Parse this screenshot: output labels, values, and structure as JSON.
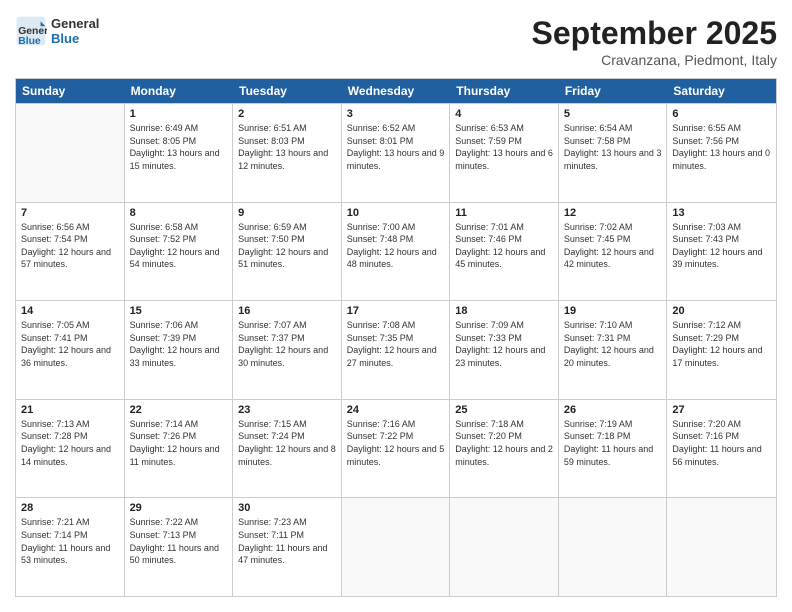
{
  "header": {
    "logo_general": "General",
    "logo_blue": "Blue",
    "month_title": "September 2025",
    "subtitle": "Cravanzana, Piedmont, Italy"
  },
  "days_of_week": [
    "Sunday",
    "Monday",
    "Tuesday",
    "Wednesday",
    "Thursday",
    "Friday",
    "Saturday"
  ],
  "weeks": [
    [
      {
        "day": "",
        "sunrise": "",
        "sunset": "",
        "daylight": ""
      },
      {
        "day": "1",
        "sunrise": "Sunrise: 6:49 AM",
        "sunset": "Sunset: 8:05 PM",
        "daylight": "Daylight: 13 hours and 15 minutes."
      },
      {
        "day": "2",
        "sunrise": "Sunrise: 6:51 AM",
        "sunset": "Sunset: 8:03 PM",
        "daylight": "Daylight: 13 hours and 12 minutes."
      },
      {
        "day": "3",
        "sunrise": "Sunrise: 6:52 AM",
        "sunset": "Sunset: 8:01 PM",
        "daylight": "Daylight: 13 hours and 9 minutes."
      },
      {
        "day": "4",
        "sunrise": "Sunrise: 6:53 AM",
        "sunset": "Sunset: 7:59 PM",
        "daylight": "Daylight: 13 hours and 6 minutes."
      },
      {
        "day": "5",
        "sunrise": "Sunrise: 6:54 AM",
        "sunset": "Sunset: 7:58 PM",
        "daylight": "Daylight: 13 hours and 3 minutes."
      },
      {
        "day": "6",
        "sunrise": "Sunrise: 6:55 AM",
        "sunset": "Sunset: 7:56 PM",
        "daylight": "Daylight: 13 hours and 0 minutes."
      }
    ],
    [
      {
        "day": "7",
        "sunrise": "Sunrise: 6:56 AM",
        "sunset": "Sunset: 7:54 PM",
        "daylight": "Daylight: 12 hours and 57 minutes."
      },
      {
        "day": "8",
        "sunrise": "Sunrise: 6:58 AM",
        "sunset": "Sunset: 7:52 PM",
        "daylight": "Daylight: 12 hours and 54 minutes."
      },
      {
        "day": "9",
        "sunrise": "Sunrise: 6:59 AM",
        "sunset": "Sunset: 7:50 PM",
        "daylight": "Daylight: 12 hours and 51 minutes."
      },
      {
        "day": "10",
        "sunrise": "Sunrise: 7:00 AM",
        "sunset": "Sunset: 7:48 PM",
        "daylight": "Daylight: 12 hours and 48 minutes."
      },
      {
        "day": "11",
        "sunrise": "Sunrise: 7:01 AM",
        "sunset": "Sunset: 7:46 PM",
        "daylight": "Daylight: 12 hours and 45 minutes."
      },
      {
        "day": "12",
        "sunrise": "Sunrise: 7:02 AM",
        "sunset": "Sunset: 7:45 PM",
        "daylight": "Daylight: 12 hours and 42 minutes."
      },
      {
        "day": "13",
        "sunrise": "Sunrise: 7:03 AM",
        "sunset": "Sunset: 7:43 PM",
        "daylight": "Daylight: 12 hours and 39 minutes."
      }
    ],
    [
      {
        "day": "14",
        "sunrise": "Sunrise: 7:05 AM",
        "sunset": "Sunset: 7:41 PM",
        "daylight": "Daylight: 12 hours and 36 minutes."
      },
      {
        "day": "15",
        "sunrise": "Sunrise: 7:06 AM",
        "sunset": "Sunset: 7:39 PM",
        "daylight": "Daylight: 12 hours and 33 minutes."
      },
      {
        "day": "16",
        "sunrise": "Sunrise: 7:07 AM",
        "sunset": "Sunset: 7:37 PM",
        "daylight": "Daylight: 12 hours and 30 minutes."
      },
      {
        "day": "17",
        "sunrise": "Sunrise: 7:08 AM",
        "sunset": "Sunset: 7:35 PM",
        "daylight": "Daylight: 12 hours and 27 minutes."
      },
      {
        "day": "18",
        "sunrise": "Sunrise: 7:09 AM",
        "sunset": "Sunset: 7:33 PM",
        "daylight": "Daylight: 12 hours and 23 minutes."
      },
      {
        "day": "19",
        "sunrise": "Sunrise: 7:10 AM",
        "sunset": "Sunset: 7:31 PM",
        "daylight": "Daylight: 12 hours and 20 minutes."
      },
      {
        "day": "20",
        "sunrise": "Sunrise: 7:12 AM",
        "sunset": "Sunset: 7:29 PM",
        "daylight": "Daylight: 12 hours and 17 minutes."
      }
    ],
    [
      {
        "day": "21",
        "sunrise": "Sunrise: 7:13 AM",
        "sunset": "Sunset: 7:28 PM",
        "daylight": "Daylight: 12 hours and 14 minutes."
      },
      {
        "day": "22",
        "sunrise": "Sunrise: 7:14 AM",
        "sunset": "Sunset: 7:26 PM",
        "daylight": "Daylight: 12 hours and 11 minutes."
      },
      {
        "day": "23",
        "sunrise": "Sunrise: 7:15 AM",
        "sunset": "Sunset: 7:24 PM",
        "daylight": "Daylight: 12 hours and 8 minutes."
      },
      {
        "day": "24",
        "sunrise": "Sunrise: 7:16 AM",
        "sunset": "Sunset: 7:22 PM",
        "daylight": "Daylight: 12 hours and 5 minutes."
      },
      {
        "day": "25",
        "sunrise": "Sunrise: 7:18 AM",
        "sunset": "Sunset: 7:20 PM",
        "daylight": "Daylight: 12 hours and 2 minutes."
      },
      {
        "day": "26",
        "sunrise": "Sunrise: 7:19 AM",
        "sunset": "Sunset: 7:18 PM",
        "daylight": "Daylight: 11 hours and 59 minutes."
      },
      {
        "day": "27",
        "sunrise": "Sunrise: 7:20 AM",
        "sunset": "Sunset: 7:16 PM",
        "daylight": "Daylight: 11 hours and 56 minutes."
      }
    ],
    [
      {
        "day": "28",
        "sunrise": "Sunrise: 7:21 AM",
        "sunset": "Sunset: 7:14 PM",
        "daylight": "Daylight: 11 hours and 53 minutes."
      },
      {
        "day": "29",
        "sunrise": "Sunrise: 7:22 AM",
        "sunset": "Sunset: 7:13 PM",
        "daylight": "Daylight: 11 hours and 50 minutes."
      },
      {
        "day": "30",
        "sunrise": "Sunrise: 7:23 AM",
        "sunset": "Sunset: 7:11 PM",
        "daylight": "Daylight: 11 hours and 47 minutes."
      },
      {
        "day": "",
        "sunrise": "",
        "sunset": "",
        "daylight": ""
      },
      {
        "day": "",
        "sunrise": "",
        "sunset": "",
        "daylight": ""
      },
      {
        "day": "",
        "sunrise": "",
        "sunset": "",
        "daylight": ""
      },
      {
        "day": "",
        "sunrise": "",
        "sunset": "",
        "daylight": ""
      }
    ]
  ]
}
